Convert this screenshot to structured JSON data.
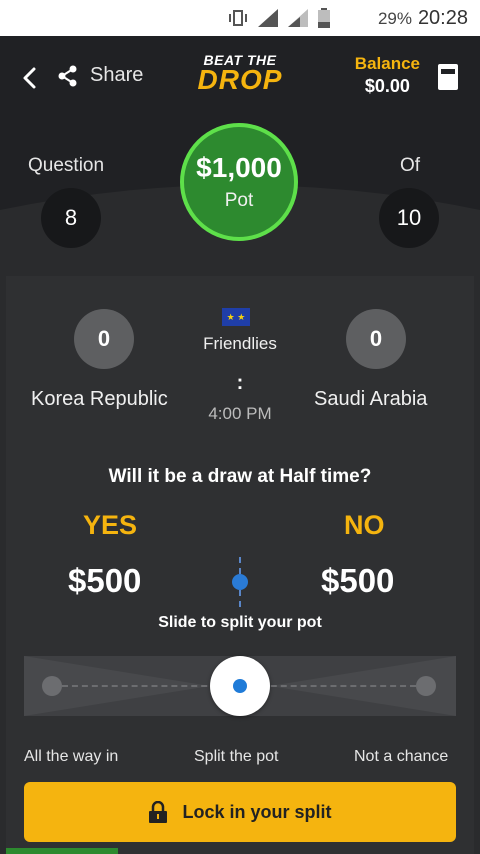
{
  "status_bar": {
    "battery_pct": "29%",
    "time": "20:28",
    "network": "H+"
  },
  "header": {
    "share_label": "Share",
    "logo_line1": "BEAT THE",
    "logo_line2": "DROP",
    "balance_label": "Balance",
    "balance_value": "$0.00"
  },
  "progress": {
    "question_label": "Question",
    "question_number": "8",
    "of_label": "Of",
    "total": "10"
  },
  "pot": {
    "amount": "$1,000",
    "label": "Pot"
  },
  "match": {
    "home_team": "Korea Republic",
    "away_team": "Saudi Arabia",
    "home_score": "0",
    "away_score": "0",
    "competition": "Friendlies",
    "separator": ":",
    "kickoff": "4:00 PM"
  },
  "question": {
    "text": "Will it be a draw at Half time?",
    "yes_label": "YES",
    "no_label": "NO",
    "yes_amount": "$500",
    "no_amount": "$500",
    "slide_help": "Slide to split your pot",
    "slider_position": 0.5,
    "left_label": "All the way in",
    "mid_label": "Split the pot",
    "right_label": "Not a chance"
  },
  "lock_button": {
    "label": "Lock in your split"
  },
  "colors": {
    "accent": "#f5b40f",
    "pot_green": "#2d8a2f",
    "slider_blue": "#1f7bd8"
  }
}
